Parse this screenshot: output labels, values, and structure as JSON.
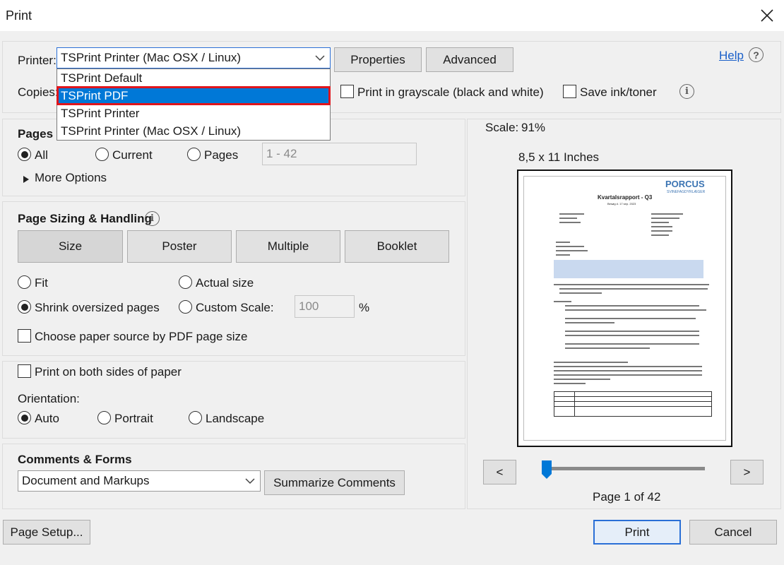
{
  "window": {
    "title": "Print"
  },
  "printer": {
    "label": "Printer:",
    "selected": "TSPrint Printer (Mac OSX / Linux)",
    "options": [
      "TSPrint Default",
      "TSPrint PDF",
      "TSPrint Printer",
      "TSPrint Printer (Mac OSX / Linux)"
    ],
    "highlighted_option": "TSPrint PDF",
    "properties_label": "Properties",
    "advanced_label": "Advanced",
    "help_label": "Help",
    "copies_label": "Copies:",
    "grayscale_label": "Print in grayscale (black and white)",
    "save_ink_label": "Save ink/toner"
  },
  "pages": {
    "heading": "Pages t",
    "all_label": "All",
    "current_label": "Current",
    "pages_label": "Pages",
    "pages_placeholder": "1 - 42",
    "more_options_label": "More Options",
    "selected": "All"
  },
  "sizing": {
    "heading": "Page Sizing & Handling",
    "tabs": [
      "Size",
      "Poster",
      "Multiple",
      "Booklet"
    ],
    "fit_label": "Fit",
    "actual_label": "Actual size",
    "shrink_label": "Shrink oversized pages",
    "custom_label": "Custom Scale:",
    "custom_value": "100",
    "percent": "%",
    "paper_source_label": "Choose paper source by PDF page size",
    "selected": "Shrink oversized pages"
  },
  "duplex": {
    "both_sides_label": "Print on both sides of paper",
    "orientation_label": "Orientation:",
    "auto_label": "Auto",
    "portrait_label": "Portrait",
    "landscape_label": "Landscape",
    "selected": "Auto"
  },
  "comments": {
    "heading": "Comments & Forms",
    "selected": "Document and Markups",
    "summarize_label": "Summarize Comments"
  },
  "preview": {
    "scale_label": "Scale:",
    "scale_value": "91%",
    "paper_size": "8,5 x 11 Inches",
    "prev_label": "<",
    "next_label": ">",
    "page_indicator": "Page 1 of 42",
    "slider_fraction": 0.0
  },
  "doc": {
    "logo": "PORCUS",
    "logo_sub": "SVINEFAGDYRLÆGER",
    "title": "Kvartalsrapport - Q3",
    "subtitle": "Besøg d. 17 sep. 2023"
  },
  "footer": {
    "page_setup_label": "Page Setup...",
    "print_label": "Print",
    "cancel_label": "Cancel"
  },
  "colors": {
    "accent": "#0078d7",
    "highlight_border": "#e0151c",
    "link": "#1a5fc9",
    "slider": "#0078d7"
  }
}
